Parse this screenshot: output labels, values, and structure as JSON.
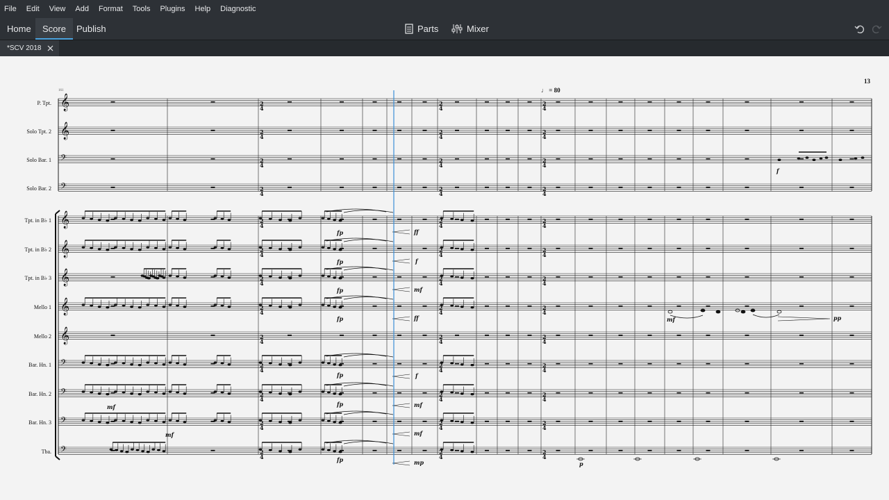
{
  "menu": [
    "File",
    "Edit",
    "View",
    "Add",
    "Format",
    "Tools",
    "Plugins",
    "Help",
    "Diagnostic"
  ],
  "tabs": {
    "home": "Home",
    "score": "Score",
    "publish": "Publish"
  },
  "tools": {
    "parts": "Parts",
    "mixer": "Mixer"
  },
  "document": {
    "title": "*SCV 2018"
  },
  "score": {
    "page_number": "13",
    "tempo": "= 80",
    "measure_number": "161",
    "staves": [
      "P. Tpt.",
      "Solo Tpt. 2",
      "Solo Bar. 1",
      "Solo Bar. 2",
      "Tpt. in B♭ 1",
      "Tpt. in B♭ 2",
      "Tpt. in B♭ 3",
      "Mello 1",
      "Mello 2",
      "Bar. Hn. 1",
      "Bar. Hn. 2",
      "Bar. Hn. 3",
      "Tba."
    ],
    "dynamics": [
      "fp",
      "ff",
      "f",
      "mf",
      "mp",
      "pp",
      "p"
    ]
  },
  "colors": {
    "menubar": "#2d3136",
    "canvas": "#f3f3f3",
    "accent": "#4aa3df",
    "playhead": "#3b8fd6"
  }
}
